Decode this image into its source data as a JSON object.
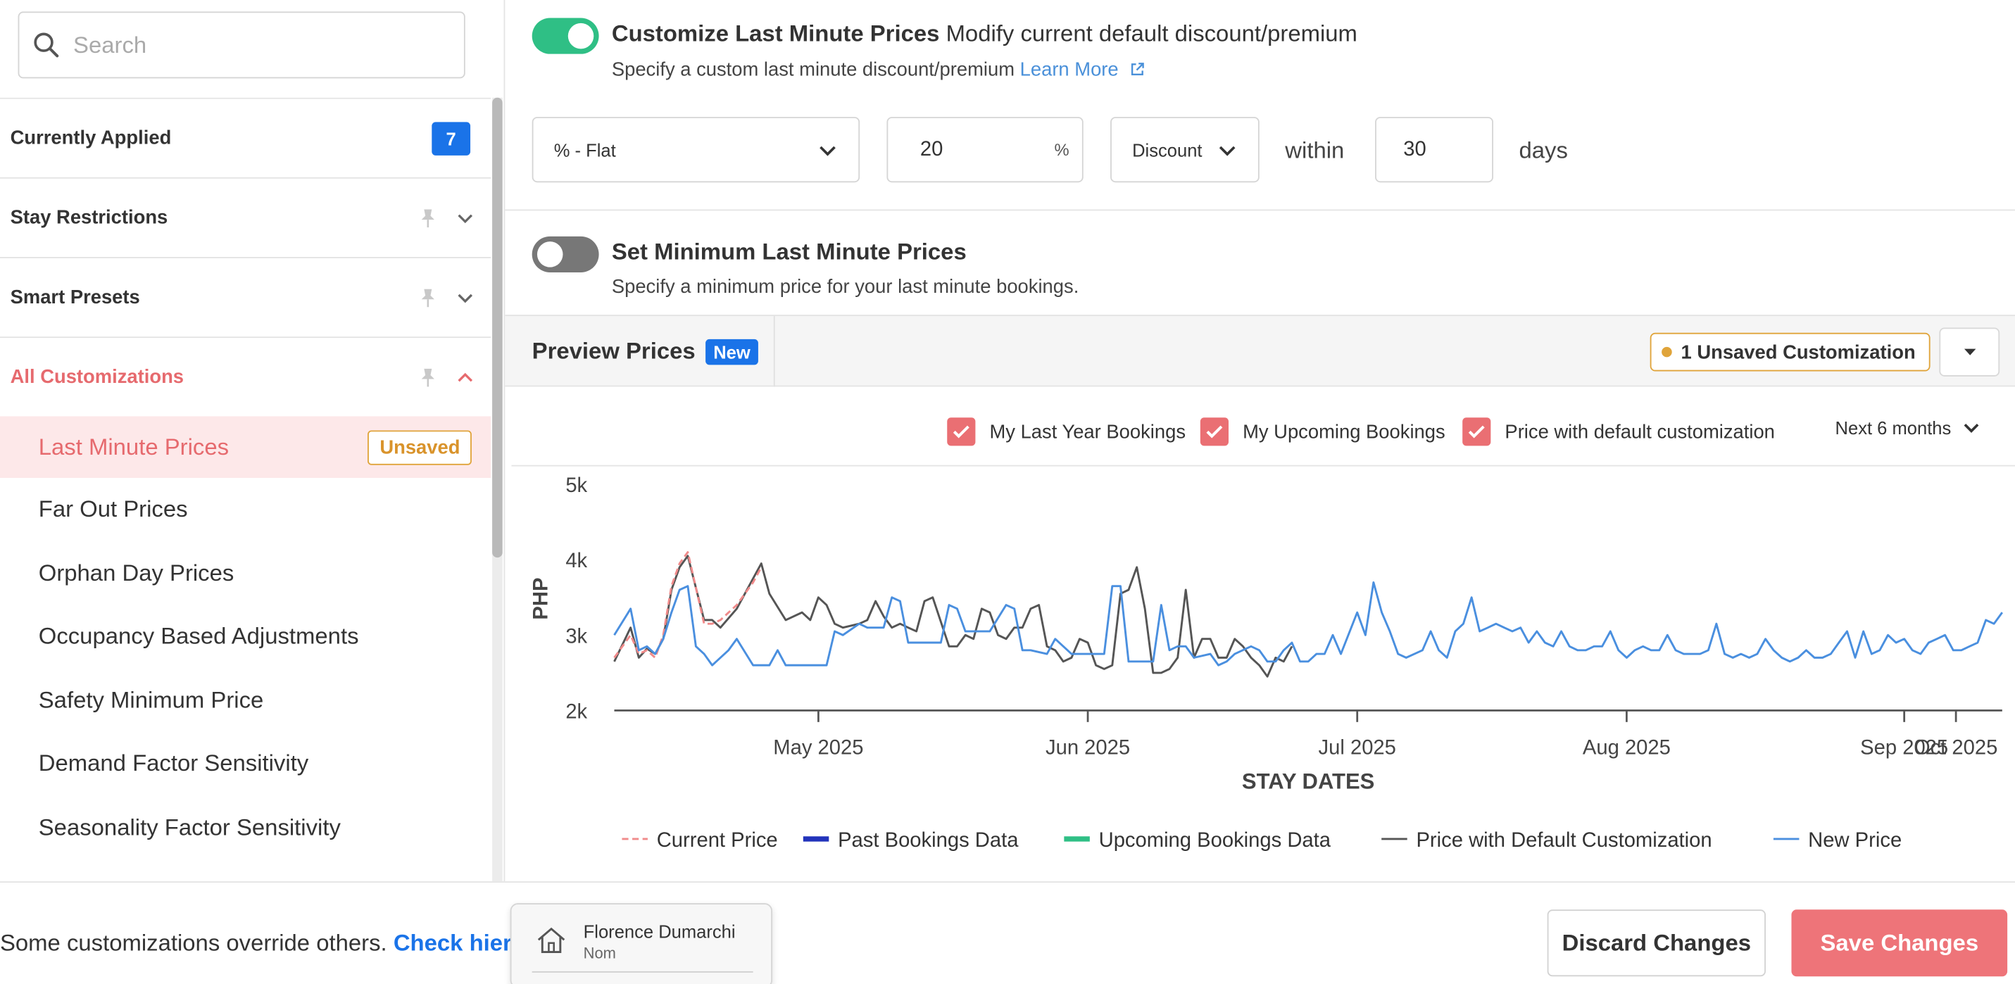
{
  "search": {
    "placeholder": "Search",
    "value": ""
  },
  "sidebar": {
    "sections": [
      {
        "label": "Currently Applied",
        "count": "7"
      },
      {
        "label": "Stay Restrictions"
      },
      {
        "label": "Smart Presets"
      },
      {
        "label": "All Customizations"
      }
    ],
    "items": [
      {
        "label": "Last Minute Prices",
        "tag": "Unsaved"
      },
      {
        "label": "Far Out Prices"
      },
      {
        "label": "Orphan Day Prices"
      },
      {
        "label": "Occupancy Based Adjustments"
      },
      {
        "label": "Safety Minimum Price"
      },
      {
        "label": "Demand Factor Sensitivity"
      },
      {
        "label": "Seasonality Factor Sensitivity"
      }
    ]
  },
  "customize": {
    "enabled": true,
    "title": "Customize Last Minute Prices",
    "subtitle": "Modify current default discount/premium",
    "desc": "Specify a custom last minute discount/premium",
    "learn_more": "Learn More",
    "type_value": "% - Flat",
    "amount_value": "20",
    "amount_unit": "%",
    "direction_value": "Discount",
    "within_label": "within",
    "days_value": "30",
    "days_label": "days"
  },
  "minimum": {
    "enabled": false,
    "title": "Set Minimum Last Minute Prices",
    "desc": "Specify a minimum price for your last minute bookings."
  },
  "preview": {
    "tab_label": "Preview Prices",
    "new_badge": "New",
    "unsaved_label": "1 Unsaved Customization",
    "filters": [
      {
        "label": "My Last Year Bookings",
        "checked": true
      },
      {
        "label": "My Upcoming Bookings",
        "checked": true
      },
      {
        "label": "Price with default customization",
        "checked": true
      }
    ],
    "period": "Next 6 months"
  },
  "chart_data": {
    "type": "line",
    "xlabel": "STAY DATES",
    "ylabel": "PHP",
    "ylim": [
      2000,
      5000
    ],
    "yticks": [
      "2k",
      "3k",
      "4k",
      "5k"
    ],
    "xticks": [
      "May 2025",
      "Jun 2025",
      "Jul 2025",
      "Aug 2025",
      "Sep 2025",
      "Oct 2025"
    ],
    "legend_position": "bottom",
    "legend": [
      {
        "name": "Current Price",
        "color": "#f08a8a",
        "style": "dashed"
      },
      {
        "name": "Past Bookings Data",
        "color": "#2233bb",
        "style": "solid"
      },
      {
        "name": "Upcoming Bookings Data",
        "color": "#2fbf85",
        "style": "solid"
      },
      {
        "name": "Price with Default Customization",
        "color": "#555555",
        "style": "solid"
      },
      {
        "name": "New Price",
        "color": "#4a8fdf",
        "style": "solid"
      }
    ],
    "series": [
      {
        "name": "Price with Default Customization",
        "color": "#555555",
        "points": [
          [
            0,
            2650
          ],
          [
            2,
            3100
          ],
          [
            3,
            2700
          ],
          [
            4,
            2820
          ],
          [
            5,
            2750
          ],
          [
            6,
            2950
          ],
          [
            7,
            3600
          ],
          [
            8,
            3900
          ],
          [
            9,
            4050
          ],
          [
            11,
            3200
          ],
          [
            12,
            3200
          ],
          [
            13,
            3100
          ],
          [
            15,
            3350
          ],
          [
            17,
            3750
          ],
          [
            18,
            3950
          ],
          [
            19,
            3550
          ],
          [
            21,
            3200
          ],
          [
            23,
            3300
          ],
          [
            24,
            3200
          ],
          [
            25,
            3500
          ],
          [
            26,
            3400
          ],
          [
            27,
            3150
          ],
          [
            28,
            3100
          ],
          [
            30,
            3150
          ],
          [
            31,
            3200
          ],
          [
            32,
            3450
          ],
          [
            33,
            3250
          ],
          [
            34,
            3100
          ],
          [
            35,
            3150
          ],
          [
            36,
            3100
          ],
          [
            37,
            3050
          ],
          [
            38,
            3450
          ],
          [
            39,
            3500
          ],
          [
            41,
            2850
          ],
          [
            42,
            2850
          ],
          [
            43,
            3000
          ],
          [
            44,
            2950
          ],
          [
            45,
            3350
          ],
          [
            46,
            3300
          ],
          [
            47,
            3000
          ],
          [
            48,
            2950
          ],
          [
            49,
            3100
          ],
          [
            50,
            3100
          ],
          [
            51,
            3350
          ],
          [
            52,
            3400
          ],
          [
            53,
            2850
          ],
          [
            54,
            2800
          ],
          [
            55,
            2650
          ],
          [
            56,
            2700
          ],
          [
            57,
            2950
          ],
          [
            58,
            2900
          ],
          [
            59,
            2600
          ],
          [
            60,
            2550
          ],
          [
            61,
            2600
          ],
          [
            62,
            3550
          ],
          [
            63,
            3600
          ],
          [
            64,
            3900
          ],
          [
            65,
            3350
          ],
          [
            66,
            2500
          ],
          [
            67,
            2500
          ],
          [
            68,
            2550
          ],
          [
            69,
            2700
          ],
          [
            70,
            3600
          ],
          [
            71,
            2700
          ],
          [
            72,
            2950
          ],
          [
            73,
            2950
          ],
          [
            74,
            2700
          ],
          [
            75,
            2700
          ],
          [
            76,
            2950
          ],
          [
            77,
            2850
          ],
          [
            78,
            2700
          ],
          [
            79,
            2600
          ],
          [
            80,
            2450
          ],
          [
            81,
            2700
          ],
          [
            82,
            2650
          ],
          [
            83,
            2850
          ]
        ]
      },
      {
        "name": "Current Price",
        "color": "#f08a8a",
        "points": [
          [
            0,
            2700
          ],
          [
            2,
            3000
          ],
          [
            3,
            2750
          ],
          [
            4,
            2800
          ],
          [
            5,
            2700
          ],
          [
            6,
            3000
          ],
          [
            7,
            3650
          ],
          [
            8,
            3950
          ],
          [
            9,
            4100
          ],
          [
            11,
            3150
          ],
          [
            12,
            3150
          ],
          [
            13,
            3200
          ],
          [
            15,
            3400
          ],
          [
            17,
            3700
          ],
          [
            18,
            3900
          ]
        ]
      },
      {
        "name": "New Price",
        "color": "#4a8fdf",
        "points": [
          [
            0,
            3000
          ],
          [
            2,
            3350
          ],
          [
            3,
            2800
          ],
          [
            4,
            2850
          ],
          [
            5,
            2750
          ],
          [
            6,
            2950
          ],
          [
            7,
            3300
          ],
          [
            8,
            3600
          ],
          [
            9,
            3650
          ],
          [
            10,
            2850
          ],
          [
            11,
            2750
          ],
          [
            12,
            2600
          ],
          [
            14,
            2800
          ],
          [
            15,
            2950
          ],
          [
            17,
            2600
          ],
          [
            19,
            2600
          ],
          [
            20,
            2800
          ],
          [
            21,
            2600
          ],
          [
            23,
            2600
          ],
          [
            26,
            2600
          ],
          [
            27,
            3050
          ],
          [
            28,
            3000
          ],
          [
            30,
            3150
          ],
          [
            31,
            3100
          ],
          [
            33,
            3100
          ],
          [
            34,
            3500
          ],
          [
            35,
            3450
          ],
          [
            36,
            2900
          ],
          [
            37,
            2900
          ],
          [
            40,
            2900
          ],
          [
            41,
            3400
          ],
          [
            42,
            3350
          ],
          [
            43,
            3050
          ],
          [
            46,
            3050
          ],
          [
            48,
            3400
          ],
          [
            49,
            3350
          ],
          [
            50,
            2800
          ],
          [
            51,
            2800
          ],
          [
            53,
            2750
          ],
          [
            54,
            2950
          ],
          [
            55,
            2850
          ],
          [
            56,
            2750
          ],
          [
            57,
            2750
          ],
          [
            60,
            2750
          ],
          [
            61,
            3650
          ],
          [
            62,
            3650
          ],
          [
            63,
            2650
          ],
          [
            66,
            2650
          ],
          [
            67,
            3400
          ],
          [
            68,
            2800
          ],
          [
            69,
            2850
          ],
          [
            70,
            2850
          ],
          [
            71,
            2700
          ],
          [
            73,
            2750
          ],
          [
            74,
            2600
          ],
          [
            75,
            2650
          ],
          [
            76,
            2750
          ],
          [
            78,
            2850
          ],
          [
            79,
            2800
          ],
          [
            80,
            2650
          ],
          [
            81,
            2650
          ],
          [
            82,
            2800
          ],
          [
            83,
            2900
          ],
          [
            84,
            2650
          ],
          [
            85,
            2650
          ],
          [
            86,
            2750
          ],
          [
            87,
            2750
          ],
          [
            88,
            3000
          ],
          [
            89,
            2750
          ],
          [
            91,
            3300
          ],
          [
            92,
            3000
          ],
          [
            93,
            3700
          ],
          [
            94,
            3300
          ],
          [
            95,
            3050
          ],
          [
            96,
            2750
          ],
          [
            97,
            2700
          ],
          [
            98,
            2750
          ],
          [
            99,
            2800
          ],
          [
            100,
            3050
          ],
          [
            101,
            2800
          ],
          [
            102,
            2700
          ],
          [
            103,
            3050
          ],
          [
            104,
            3150
          ],
          [
            105,
            3500
          ],
          [
            106,
            3050
          ],
          [
            107,
            3100
          ],
          [
            108,
            3150
          ],
          [
            109,
            3100
          ],
          [
            110,
            3050
          ],
          [
            111,
            3100
          ],
          [
            112,
            2900
          ],
          [
            113,
            3050
          ],
          [
            114,
            2900
          ],
          [
            115,
            2850
          ],
          [
            116,
            3050
          ],
          [
            117,
            2850
          ],
          [
            118,
            2800
          ],
          [
            119,
            2800
          ],
          [
            120,
            2850
          ],
          [
            121,
            2850
          ],
          [
            122,
            3050
          ],
          [
            123,
            2800
          ],
          [
            124,
            2700
          ],
          [
            125,
            2800
          ],
          [
            126,
            2850
          ],
          [
            127,
            2800
          ],
          [
            128,
            2800
          ],
          [
            129,
            3000
          ],
          [
            130,
            2800
          ],
          [
            131,
            2750
          ],
          [
            132,
            2750
          ],
          [
            133,
            2750
          ],
          [
            134,
            2800
          ],
          [
            135,
            3150
          ],
          [
            136,
            2750
          ],
          [
            137,
            2700
          ],
          [
            138,
            2750
          ],
          [
            139,
            2700
          ],
          [
            140,
            2750
          ],
          [
            141,
            2950
          ],
          [
            142,
            2800
          ],
          [
            143,
            2700
          ],
          [
            144,
            2650
          ],
          [
            145,
            2700
          ],
          [
            146,
            2800
          ],
          [
            147,
            2700
          ],
          [
            148,
            2700
          ],
          [
            149,
            2750
          ],
          [
            150,
            2900
          ],
          [
            151,
            3050
          ],
          [
            152,
            2700
          ],
          [
            153,
            3050
          ],
          [
            154,
            2750
          ],
          [
            155,
            2800
          ],
          [
            156,
            3000
          ],
          [
            157,
            2900
          ],
          [
            158,
            2950
          ],
          [
            159,
            2800
          ],
          [
            160,
            2750
          ],
          [
            161,
            2900
          ],
          [
            162,
            2950
          ],
          [
            163,
            3000
          ],
          [
            164,
            2800
          ],
          [
            165,
            2800
          ],
          [
            166,
            2850
          ],
          [
            167,
            2900
          ],
          [
            168,
            3200
          ],
          [
            169,
            3150
          ],
          [
            170,
            3300
          ]
        ]
      }
    ]
  },
  "footer": {
    "note": "Some customizations override others.",
    "link": "Check hierarchy"
  },
  "listing": {
    "name": "Florence Dumarchi",
    "sub": "Nom"
  },
  "actions": {
    "discard": "Discard Changes",
    "save": "Save Changes"
  },
  "colors": {
    "accent": "#ee7479",
    "toggle_on": "#2fbf85",
    "badge_blue": "#1a73e8",
    "warning": "#e0a43a"
  }
}
